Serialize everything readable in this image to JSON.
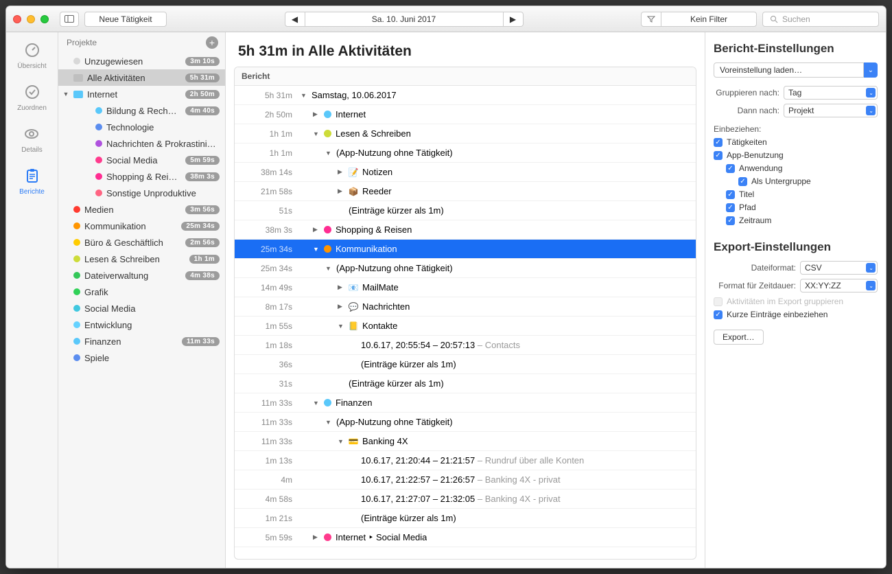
{
  "toolbar": {
    "new_activity": "Neue Tätigkeit",
    "date": "Sa. 10. Juni 2017",
    "filter": "Kein Filter",
    "search_placeholder": "Suchen"
  },
  "nav": {
    "overview": "Übersicht",
    "assign": "Zuordnen",
    "details": "Details",
    "reports": "Berichte"
  },
  "sidebar": {
    "header": "Projekte",
    "items": [
      {
        "label": "Unzugewiesen",
        "badge": "3m 10s",
        "indent": 0,
        "type": "dot",
        "color": "#d8d8d8",
        "disclosure": ""
      },
      {
        "label": "Alle Aktivitäten",
        "badge": "5h 31m",
        "indent": 0,
        "type": "folder-gray",
        "disclosure": "",
        "selected": true
      },
      {
        "label": "Internet",
        "badge": "2h 50m",
        "indent": 0,
        "type": "folder",
        "disclosure": "▼"
      },
      {
        "label": "Bildung & Rech…",
        "badge": "4m 40s",
        "indent": 2,
        "type": "dot",
        "color": "#5ac8fa"
      },
      {
        "label": "Technologie",
        "badge": "",
        "indent": 2,
        "type": "dot",
        "color": "#5b8def"
      },
      {
        "label": "Nachrichten & Prokrastini…",
        "badge": "",
        "indent": 2,
        "type": "dot",
        "color": "#af52de"
      },
      {
        "label": "Social Media",
        "badge": "5m 59s",
        "indent": 2,
        "type": "dot",
        "color": "#ff3b8d"
      },
      {
        "label": "Shopping & Rei…",
        "badge": "38m 3s",
        "indent": 2,
        "type": "dot",
        "color": "#ff2d92"
      },
      {
        "label": "Sonstige Unproduktive",
        "badge": "",
        "indent": 2,
        "type": "dot",
        "color": "#ff6482"
      },
      {
        "label": "Medien",
        "badge": "3m 56s",
        "indent": 0,
        "type": "dot",
        "color": "#ff3b30"
      },
      {
        "label": "Kommunikation",
        "badge": "25m 34s",
        "indent": 0,
        "type": "dot",
        "color": "#ff9500"
      },
      {
        "label": "Büro & Geschäftlich",
        "badge": "2m 56s",
        "indent": 0,
        "type": "dot",
        "color": "#ffcc00"
      },
      {
        "label": "Lesen & Schreiben",
        "badge": "1h 1m",
        "indent": 0,
        "type": "dot",
        "color": "#cddc39"
      },
      {
        "label": "Dateiverwaltung",
        "badge": "4m 38s",
        "indent": 0,
        "type": "dot",
        "color": "#34c759"
      },
      {
        "label": "Grafik",
        "badge": "",
        "indent": 0,
        "type": "dot",
        "color": "#30d158"
      },
      {
        "label": "Social Media",
        "badge": "",
        "indent": 0,
        "type": "dot",
        "color": "#40c8e0"
      },
      {
        "label": "Entwicklung",
        "badge": "",
        "indent": 0,
        "type": "dot",
        "color": "#64d2ff"
      },
      {
        "label": "Finanzen",
        "badge": "11m 33s",
        "indent": 0,
        "type": "dot",
        "color": "#5ac8fa"
      },
      {
        "label": "Spiele",
        "badge": "",
        "indent": 0,
        "type": "dot",
        "color": "#5b8def"
      }
    ]
  },
  "content": {
    "title": "5h 31m in Alle Aktivitäten",
    "report_header": "Bericht",
    "rows": [
      {
        "time": "5h 31m",
        "lvl": 0,
        "disc": "▼",
        "text": "Samstag, 10.06.2017"
      },
      {
        "time": "2h 50m",
        "lvl": 1,
        "disc": "▶",
        "dot": "#5ac8fa",
        "text": "Internet"
      },
      {
        "time": "1h 1m",
        "lvl": 1,
        "disc": "▼",
        "dot": "#cddc39",
        "text": "Lesen & Schreiben"
      },
      {
        "time": "1h 1m",
        "lvl": 2,
        "disc": "▼",
        "text": "(App-Nutzung ohne Tätigkeit)"
      },
      {
        "time": "38m 14s",
        "lvl": 3,
        "disc": "▶",
        "icon": "📝",
        "text": "Notizen"
      },
      {
        "time": "21m 58s",
        "lvl": 3,
        "disc": "▶",
        "icon": "📦",
        "text": "Reeder"
      },
      {
        "time": "51s",
        "lvl": 3,
        "text": "(Einträge kürzer als 1m)"
      },
      {
        "time": "38m 3s",
        "lvl": 1,
        "disc": "▶",
        "dot": "#ff2d92",
        "text": "Shopping & Reisen"
      },
      {
        "time": "25m 34s",
        "lvl": 1,
        "disc": "▼",
        "dot": "#ff9500",
        "text": "Kommunikation",
        "selected": true
      },
      {
        "time": "25m 34s",
        "lvl": 2,
        "disc": "▼",
        "text": "(App-Nutzung ohne Tätigkeit)"
      },
      {
        "time": "14m 49s",
        "lvl": 3,
        "disc": "▶",
        "icon": "📧",
        "text": "MailMate"
      },
      {
        "time": "8m 17s",
        "lvl": 3,
        "disc": "▶",
        "icon": "💬",
        "text": "Nachrichten"
      },
      {
        "time": "1m 55s",
        "lvl": 3,
        "disc": "▼",
        "icon": "📒",
        "text": "Kontakte"
      },
      {
        "time": "1m 18s",
        "lvl": 4,
        "text": "10.6.17, 20:55:54 – 20:57:13",
        "sub": " – Contacts"
      },
      {
        "time": "36s",
        "lvl": 4,
        "text": "(Einträge kürzer als 1m)"
      },
      {
        "time": "31s",
        "lvl": 3,
        "text": "(Einträge kürzer als 1m)"
      },
      {
        "time": "11m 33s",
        "lvl": 1,
        "disc": "▼",
        "dot": "#5ac8fa",
        "text": "Finanzen"
      },
      {
        "time": "11m 33s",
        "lvl": 2,
        "disc": "▼",
        "text": "(App-Nutzung ohne Tätigkeit)"
      },
      {
        "time": "11m 33s",
        "lvl": 3,
        "disc": "▼",
        "icon": "💳",
        "text": "Banking 4X"
      },
      {
        "time": "1m 13s",
        "lvl": 4,
        "text": "10.6.17, 21:20:44 – 21:21:57",
        "sub": " – Rundruf über alle Konten"
      },
      {
        "time": "4m",
        "lvl": 4,
        "text": "10.6.17, 21:22:57 – 21:26:57",
        "sub": " – Banking 4X - privat"
      },
      {
        "time": "4m 58s",
        "lvl": 4,
        "text": "10.6.17, 21:27:07 – 21:32:05",
        "sub": " – Banking 4X - privat"
      },
      {
        "time": "1m 21s",
        "lvl": 4,
        "text": "(Einträge kürzer als 1m)"
      },
      {
        "time": "5m 59s",
        "lvl": 1,
        "disc": "▶",
        "dot": "#ff3b8d",
        "text": "Internet ‣ Social Media"
      }
    ]
  },
  "settings": {
    "title": "Bericht-Einstellungen",
    "preset": "Voreinstellung laden…",
    "group_by_label": "Gruppieren nach:",
    "group_by": "Tag",
    "then_by_label": "Dann nach:",
    "then_by": "Projekt",
    "include_label": "Einbeziehen:",
    "activities": "Tätigkeiten",
    "app_usage": "App-Benutzung",
    "application": "Anwendung",
    "as_subgroup": "Als Untergruppe",
    "title_chk": "Titel",
    "path": "Pfad",
    "timespan": "Zeitraum",
    "export_title": "Export-Einstellungen",
    "file_format_label": "Dateiformat:",
    "file_format": "CSV",
    "duration_format_label": "Format für Zeitdauer:",
    "duration_format": "XX:YY:ZZ",
    "group_in_export": "Aktivitäten im Export gruppieren",
    "include_short": "Kurze Einträge einbeziehen",
    "export_button": "Export…"
  }
}
